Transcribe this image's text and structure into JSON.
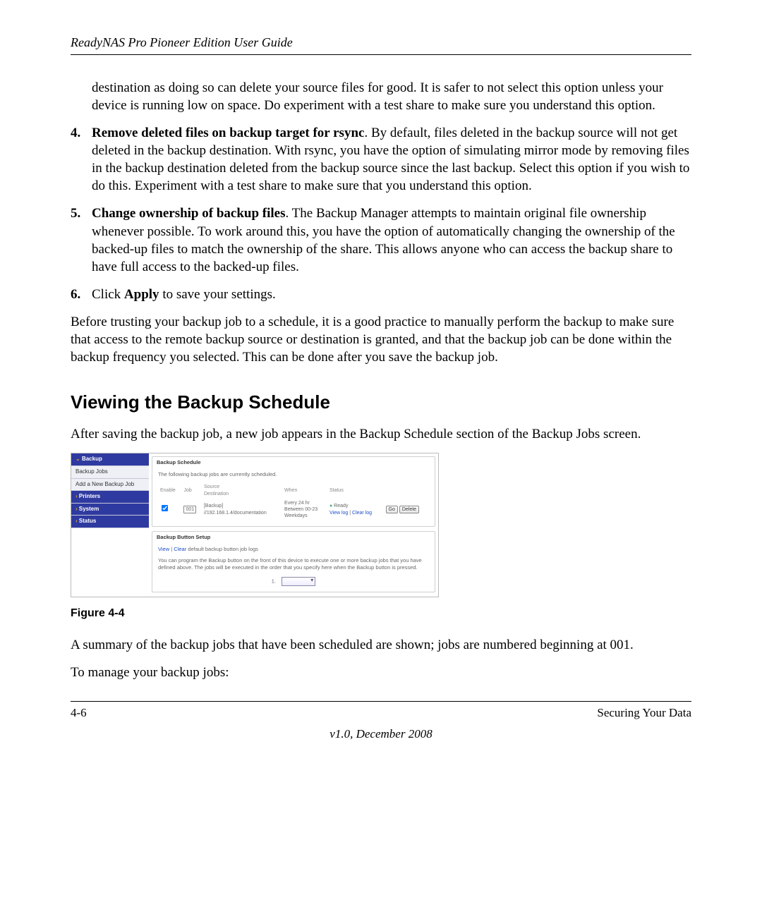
{
  "header": {
    "title": "ReadyNAS Pro Pioneer Edition User Guide"
  },
  "body": {
    "continued_paragraph": "destination as doing so can delete your source files for good. It is safer to not select this option unless your device is running low on space. Do experiment with a test share to make sure you understand this option.",
    "items": [
      {
        "num": "4.",
        "lead": "Remove deleted files on backup target for rsync",
        "rest": ". By default, files deleted in the backup source will not get deleted in the backup destination. With rsync, you have the option of simulating mirror mode by removing files in the backup destination deleted from the backup source since the last backup. Select this option if you wish to do this. Experiment with a test share to make sure that you understand this option."
      },
      {
        "num": "5.",
        "lead": "Change ownership of backup files",
        "rest": ". The Backup Manager attempts to maintain original file ownership whenever possible. To work around this, you have the option of automatically changing the ownership of the backed-up files to match the ownership of the share. This allows anyone who can access the backup share to have full access to the backed-up files."
      },
      {
        "num": "6.",
        "pre": "Click ",
        "bold": "Apply",
        "post": " to save your settings."
      }
    ],
    "followup": "Before trusting your backup job to a schedule, it is a good practice to manually perform the backup to make sure that access to the remote backup source or destination is granted, and that the backup job can be done within the backup frequency you selected. This can be done after you save the backup job.",
    "section_heading": "Viewing the Backup Schedule",
    "section_intro": "After saving the backup job, a new job appears in the Backup Schedule section of the Backup Jobs screen.",
    "figure_caption": "Figure 4-4",
    "summary": "A summary of the backup jobs that have been scheduled are shown; jobs are numbered beginning at 001.",
    "manage_intro": "To manage your backup jobs:"
  },
  "screenshot": {
    "sidebar": {
      "backup": "Backup",
      "backup_jobs": "Backup Jobs",
      "add_new": "Add a New Backup Job",
      "printers": "Printers",
      "system": "System",
      "status": "Status"
    },
    "schedule": {
      "title": "Backup Schedule",
      "note": "The following backup jobs are currently scheduled.",
      "headers": {
        "enable": "Enable",
        "job": "Job",
        "src": "Source\nDestination",
        "when": "When",
        "status": "Status"
      },
      "row": {
        "job": "001",
        "src_line1": "[Backup]",
        "src_line2": "//192.168.1.4/documentation",
        "when_line1": "Every 24 hr",
        "when_line2": "Between 00-23",
        "when_line3": "Weekdays",
        "status_line1": "Ready",
        "status_line2a": "View log",
        "status_line2b": "Clear log",
        "go": "Go",
        "delete": "Delete"
      }
    },
    "button_setup": {
      "title": "Backup Button Setup",
      "links_a": "View",
      "links_b": "Clear",
      "links_rest": " default backup button job logs",
      "desc": "You can program the Backup button on the front of this device to execute one or more backup jobs that you have defined above. The jobs will be executed in the order that you specify here when the Backup button is pressed.",
      "row_label": "1."
    }
  },
  "footer": {
    "left": "4-6",
    "right": "Securing Your Data",
    "version": "v1.0, December 2008"
  }
}
